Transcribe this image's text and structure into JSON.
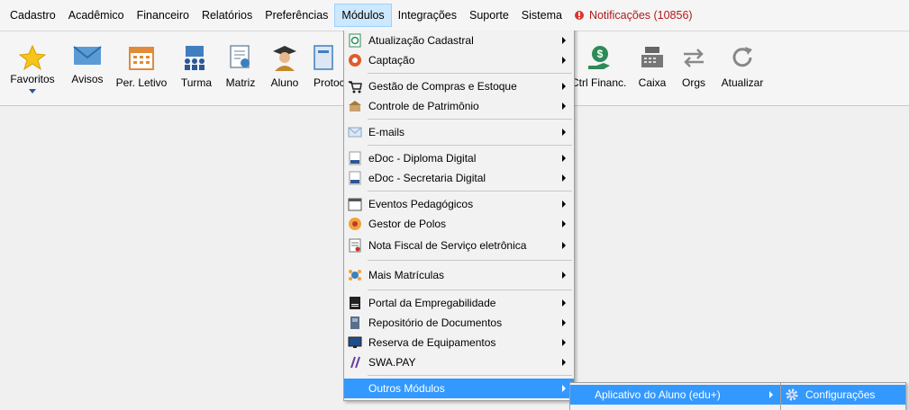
{
  "menubar": {
    "items": [
      {
        "label": "Cadastro"
      },
      {
        "label": "Acadêmico"
      },
      {
        "label": "Financeiro"
      },
      {
        "label": "Relatórios"
      },
      {
        "label": "Preferências"
      },
      {
        "label": "Módulos"
      },
      {
        "label": "Integrações"
      },
      {
        "label": "Suporte"
      },
      {
        "label": "Sistema"
      }
    ],
    "notifications": "Notificações (10856)"
  },
  "toolbar": {
    "buttons": [
      {
        "label": "Favoritos",
        "icon": "star-icon"
      },
      {
        "label": "Avisos",
        "icon": "envelope-icon"
      },
      {
        "label": "Per. Letivo",
        "icon": "calendar-icon"
      },
      {
        "label": "Turma",
        "icon": "class-icon"
      },
      {
        "label": "Matriz",
        "icon": "certificate-icon"
      },
      {
        "label": "Aluno",
        "icon": "student-icon"
      },
      {
        "label": "Protoc",
        "icon": "protocol-icon"
      },
      {
        "label": "Ctrl Financ.",
        "icon": "money-hand-icon"
      },
      {
        "label": "Caixa",
        "icon": "cash-register-icon"
      },
      {
        "label": "Orgs",
        "icon": "swap-arrows-icon"
      },
      {
        "label": "Atualizar",
        "icon": "refresh-icon"
      }
    ]
  },
  "modulos_menu": {
    "items": [
      {
        "label": "Atualização Cadastral",
        "icon": "update-icon"
      },
      {
        "label": "Captação",
        "icon": "capture-icon"
      },
      {
        "label": "Gestão de Compras e Estoque",
        "icon": "purchase-icon"
      },
      {
        "label": "Controle de Patrimônio",
        "icon": "patrimony-icon"
      },
      {
        "label": "E-mails",
        "icon": "email-icon"
      },
      {
        "label": "eDoc - Diploma Digital",
        "icon": "edoc-icon"
      },
      {
        "label": "eDoc - Secretaria Digital",
        "icon": "edoc-icon"
      },
      {
        "label": "Eventos Pedagógicos",
        "icon": "calendar-icon"
      },
      {
        "label": "Gestor de Polos",
        "icon": "poles-icon"
      },
      {
        "label": "Nota Fiscal de Serviço eletrônica",
        "icon": "invoice-icon"
      },
      {
        "label": "Mais Matrículas",
        "icon": "enrollments-icon"
      },
      {
        "label": "Portal da Empregabilidade",
        "icon": "cv-icon"
      },
      {
        "label": "Repositório de Documentos",
        "icon": "repository-icon"
      },
      {
        "label": "Reserva de Equipamentos",
        "icon": "monitor-icon"
      },
      {
        "label": "SWA.PAY",
        "icon": "swapay-icon"
      },
      {
        "label": "Outros Módulos",
        "icon": ""
      }
    ]
  },
  "outros_menu": {
    "items": [
      {
        "label": "Aplicativo do Aluno (edu+)"
      }
    ]
  },
  "app_menu": {
    "items": [
      {
        "label": "Configurações",
        "icon": "gear-icon"
      }
    ]
  }
}
